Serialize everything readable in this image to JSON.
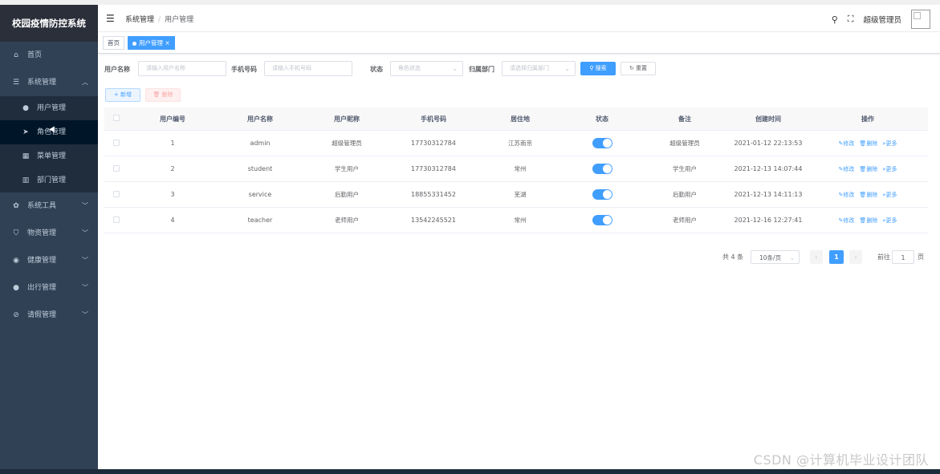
{
  "app_title": "校园疫情防控系统",
  "sidebar": {
    "items": [
      {
        "label": "首页",
        "icon": "home-icon",
        "glyph": "⌂"
      },
      {
        "label": "系统管理",
        "icon": "system-icon",
        "glyph": "☰",
        "expanded": true
      },
      {
        "label": "系统工具",
        "icon": "gear-icon",
        "glyph": "✿"
      },
      {
        "label": "物资管理",
        "icon": "bag-icon",
        "glyph": "⛉"
      },
      {
        "label": "健康管理",
        "icon": "location-icon",
        "glyph": "◉"
      },
      {
        "label": "出行管理",
        "icon": "user-icon",
        "glyph": "●"
      },
      {
        "label": "请假管理",
        "icon": "paperclip-icon",
        "glyph": "⊘"
      }
    ],
    "submenu": [
      {
        "label": "用户管理",
        "icon": "user-icon",
        "glyph": "●"
      },
      {
        "label": "角色管理",
        "icon": "send-icon",
        "glyph": "➤"
      },
      {
        "label": "菜单管理",
        "icon": "grid-icon",
        "glyph": "▦"
      },
      {
        "label": "部门管理",
        "icon": "bar-chart-icon",
        "glyph": "▥"
      }
    ]
  },
  "header": {
    "breadcrumb": [
      "系统管理",
      "用户管理"
    ],
    "username": "超级管理员"
  },
  "tags": {
    "home": "首页",
    "active": "用户管理",
    "close": "×"
  },
  "search": {
    "username_label": "用户名称",
    "username_placeholder": "请输入用户名称",
    "phone_label": "手机号码",
    "phone_placeholder": "请输入手机号码",
    "status_label": "状态",
    "status_placeholder": "角色状态",
    "dept_label": "归属部门",
    "dept_placeholder": "请选择归属部门",
    "search_btn": "搜索",
    "reset_btn": "重置"
  },
  "actions": {
    "add": "新增",
    "delete": "删除"
  },
  "table": {
    "headers": [
      "用户编号",
      "用户名称",
      "用户昵称",
      "手机号码",
      "居住地",
      "状态",
      "备注",
      "创建时间",
      "操作"
    ],
    "rows": [
      {
        "id": "1",
        "name": "admin",
        "nick": "超级管理员",
        "phone": "17730312784",
        "addr": "江苏南京",
        "note": "超级管理员",
        "time": "2021-01-12 22:13:53"
      },
      {
        "id": "2",
        "name": "student",
        "nick": "学生用户",
        "phone": "17730312784",
        "addr": "常州",
        "note": "学生用户",
        "time": "2021-12-13 14:07:44"
      },
      {
        "id": "3",
        "name": "service",
        "nick": "后勤用户",
        "phone": "18855331452",
        "addr": "芜湖",
        "note": "后勤用户",
        "time": "2021-12-13 14:11:13"
      },
      {
        "id": "4",
        "name": "teacher",
        "nick": "老师用户",
        "phone": "13542245521",
        "addr": "常州",
        "note": "老师用户",
        "time": "2021-12-16 12:27:41"
      }
    ],
    "op_edit": "修改",
    "op_delete": "删除",
    "op_more": "更多"
  },
  "pagination": {
    "total": "共 4 条",
    "page_size": "10条/页",
    "current": "1",
    "goto_label": "前往",
    "goto_value": "1",
    "goto_suffix": "页"
  },
  "watermark": "CSDN @计算机毕业设计团队",
  "colors": {
    "primary": "#409eff",
    "sidebar": "#304156",
    "danger": "#f56c6c"
  }
}
